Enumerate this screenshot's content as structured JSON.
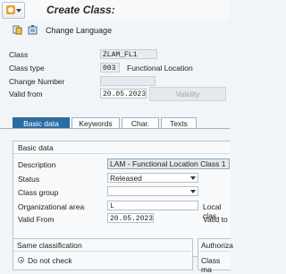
{
  "window": {
    "title": "Create Class:"
  },
  "toolbar": {
    "change_language": "Change Language"
  },
  "header": {
    "class_label": "Class",
    "class_value": "ZLAM_FL1",
    "class_type_label": "Class type",
    "class_type_value": "003",
    "class_type_text": "Functional Location",
    "change_number_label": "Change Number",
    "change_number_value": "",
    "valid_from_label": "Valid from",
    "valid_from_value": "20.05.2023",
    "validity_button": "Validity"
  },
  "tabs": [
    {
      "label": "Basic data",
      "active": true
    },
    {
      "label": "Keywords",
      "active": false
    },
    {
      "label": "Char.",
      "active": false
    },
    {
      "label": "Texts",
      "active": false
    }
  ],
  "basic_data": {
    "title": "Basic data",
    "description_label": "Description",
    "description_value": "LAM - Functional Location Class 1",
    "status_label": "Status",
    "status_value": "Released",
    "class_group_label": "Class group",
    "class_group_value": "",
    "org_area_label": "Organizational area",
    "org_area_value": "L",
    "local_class_label": "Local clas",
    "valid_from_label": "Valid From",
    "valid_from_value": "20.05.2023",
    "valid_to_label": "Valid to"
  },
  "same_classification": {
    "title": "Same classification",
    "option_label": "Do not check"
  },
  "authorization": {
    "title": "Authoriza",
    "class_maint_label": "Class ma"
  }
}
